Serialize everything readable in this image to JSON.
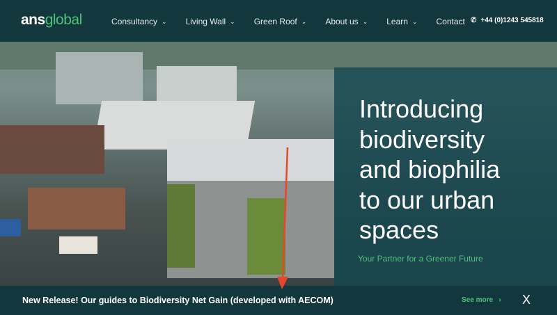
{
  "header": {
    "logo_bold": "ans",
    "logo_light": "global",
    "nav": [
      {
        "label": "Consultancy",
        "dropdown": true
      },
      {
        "label": "Living Wall",
        "dropdown": true
      },
      {
        "label": "Green Roof",
        "dropdown": true
      },
      {
        "label": "About us",
        "dropdown": true
      },
      {
        "label": "Learn",
        "dropdown": true
      },
      {
        "label": "Contact",
        "dropdown": false
      }
    ],
    "phone": "+44 (0)1243 545818"
  },
  "hero": {
    "headline": [
      "Introducing",
      "biodiversity",
      "and biophilia",
      "to our urban",
      "spaces"
    ],
    "tagline": "Your Partner for a Greener Future"
  },
  "banner": {
    "text": "New Release! Our guides to Biodiversity Net Gain (developed with AECOM)",
    "see_more": "See more",
    "chevron": "›",
    "close": "X"
  },
  "colors": {
    "brand_dark": "#12373c",
    "accent_green": "#4fc27a",
    "annotation_arrow": "#e8462a"
  }
}
